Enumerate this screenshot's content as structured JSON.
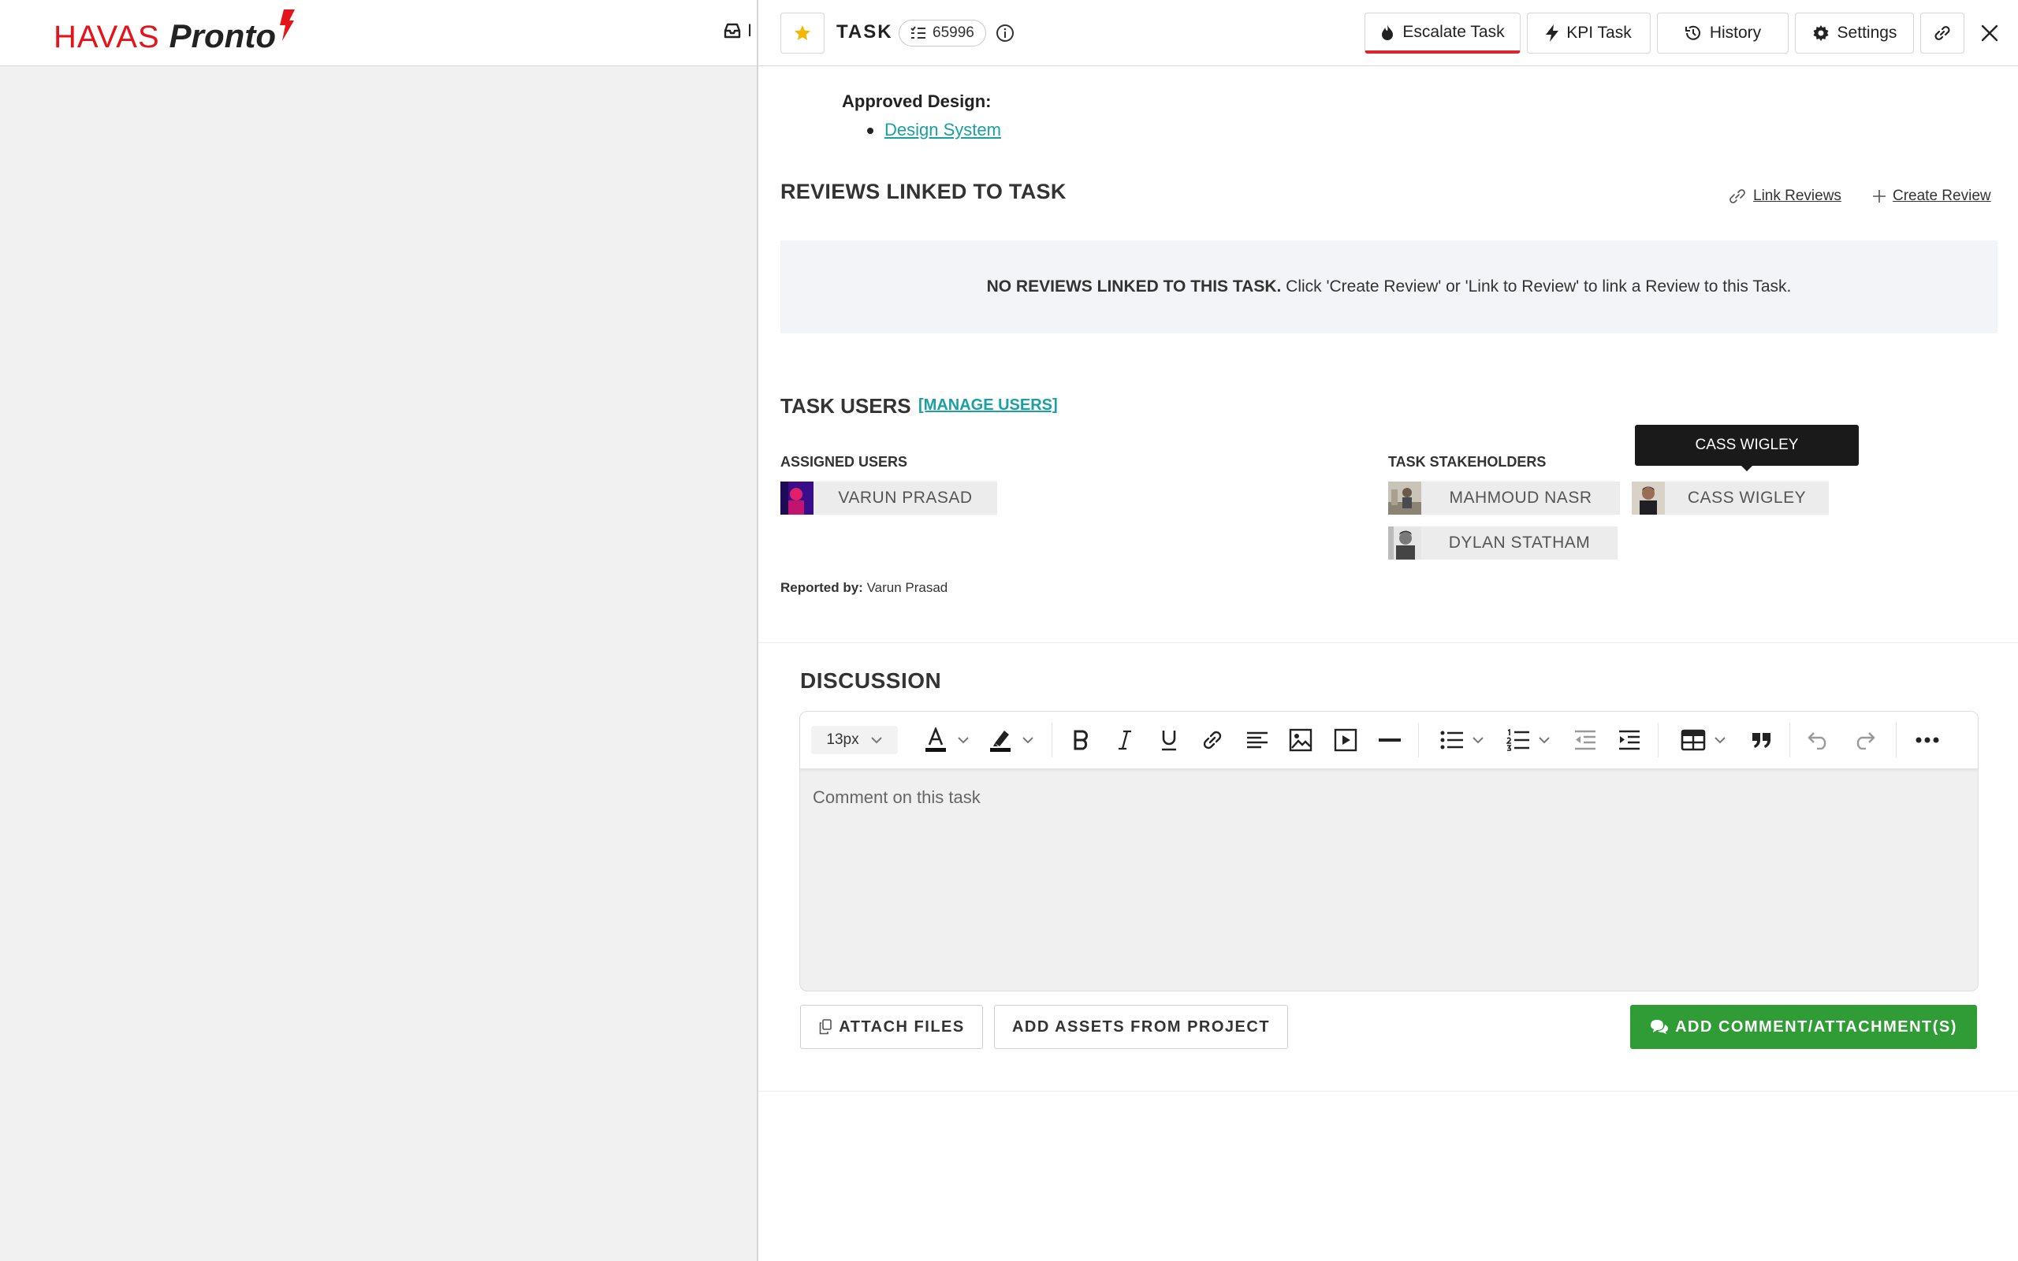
{
  "app": {
    "logo_part1": "HAVAS",
    "logo_part2": "Pronto",
    "inbox_label": "I"
  },
  "panel_header": {
    "task_label": "TASK",
    "task_id": "65996",
    "escalate_label": "Escalate Task",
    "kpi_label": "KPI Task",
    "history_label": "History",
    "settings_label": "Settings"
  },
  "approved_design": {
    "label": "Approved Design:",
    "links": [
      "Design System"
    ]
  },
  "reviews": {
    "title": "REVIEWS LINKED TO TASK",
    "link_reviews": "Link Reviews",
    "create_review": "Create Review",
    "empty_bold": "NO REVIEWS LINKED TO THIS TASK.",
    "empty_text": " Click 'Create Review' or 'Link to Review' to link a Review to this Task."
  },
  "task_users": {
    "title": "TASK USERS",
    "manage": "[MANAGE USERS]",
    "assigned_label": "ASSIGNED USERS",
    "assigned": [
      "VARUN PRASAD"
    ],
    "stakeholders_label": "TASK STAKEHOLDERS",
    "stakeholders": [
      "MAHMOUD NASR",
      "CASS WIGLEY",
      "DYLAN STATHAM"
    ],
    "tooltip": "CASS WIGLEY",
    "reported_label": "Reported by:",
    "reported_value": " Varun Prasad"
  },
  "discussion": {
    "title": "DISCUSSION",
    "font_size": "13px",
    "placeholder": "Comment on this task",
    "attach_label": "ATTACH FILES",
    "assets_label": "ADD ASSETS FROM PROJECT",
    "add_comment_label": "ADD COMMENT/ATTACHMENT(S)"
  },
  "colors": {
    "brand_red": "#e4141b",
    "link_teal": "#1a9fa3",
    "success_green": "#2f9c36",
    "star_yellow": "#f5b800"
  }
}
